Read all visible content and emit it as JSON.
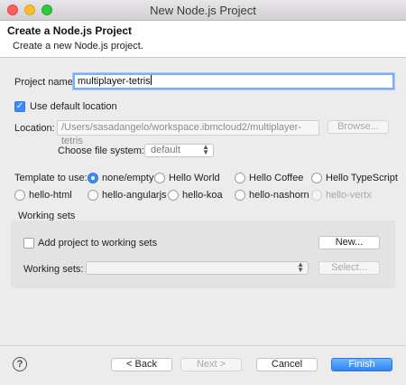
{
  "window": {
    "title": "New Node.js Project"
  },
  "banner": {
    "title": "Create a Node.js Project",
    "description": "Create a new Node.js project."
  },
  "project_name": {
    "label": "Project name:",
    "value": "multiplayer-tetris"
  },
  "use_default_location": {
    "label": "Use default location",
    "checked": true
  },
  "location": {
    "label": "Location:",
    "value": "/Users/sasadangelo/workspace.ibmcloud2/multiplayer-tetris",
    "browse_label": "Browse..."
  },
  "file_system": {
    "label": "Choose file system:",
    "selected": "default"
  },
  "template": {
    "label": "Template to use:",
    "options": [
      "none/empty",
      "Hello World",
      "Hello Coffee",
      "Hello TypeScript",
      "hello-html",
      "hello-angularjs",
      "hello-koa",
      "hello-nashorn",
      "hello-vertx"
    ],
    "selected": "none/empty",
    "disabled": [
      "hello-vertx"
    ]
  },
  "working_sets": {
    "group_label": "Working sets",
    "add_label": "Add project to working sets",
    "add_checked": false,
    "new_label": "New...",
    "sets_label": "Working sets:",
    "select_label": "Select..."
  },
  "footer": {
    "help_icon": "question-mark-icon",
    "back_label": "< Back",
    "next_label": "Next >",
    "cancel_label": "Cancel",
    "finish_label": "Finish"
  },
  "colors": {
    "accent": "#3b8cf5",
    "focus_ring": "#7aaef5"
  }
}
